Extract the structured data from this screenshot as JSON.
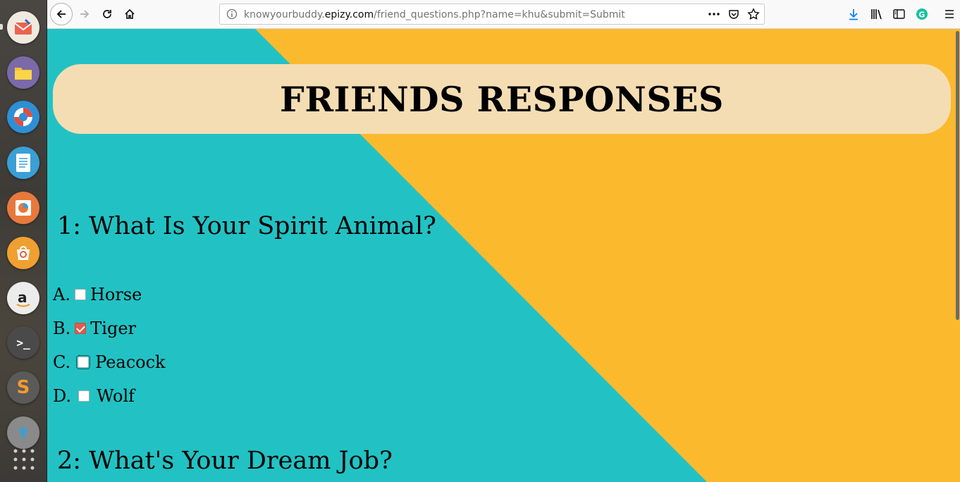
{
  "dock": {
    "items": [
      {
        "name": "mail-app-icon",
        "color": "#e9644f"
      },
      {
        "name": "files-icon",
        "color": "#7a6aa8"
      },
      {
        "name": "help-lifebuoy-icon",
        "color": "#2d8fd5"
      },
      {
        "name": "text-editor-icon",
        "color": "#3a9fd6"
      },
      {
        "name": "impress-icon",
        "color": "#e8793c"
      },
      {
        "name": "software-center-icon",
        "color": "#f0a030"
      },
      {
        "name": "amazon-icon",
        "color": "#e8e8e8"
      },
      {
        "name": "terminal-icon",
        "color": "#4a4a4a"
      },
      {
        "name": "sublime-text-icon",
        "color": "#5a5a5a"
      },
      {
        "name": "update-manager-icon",
        "color": "#6a6a6a"
      },
      {
        "name": "app-grid-icon",
        "color": "#3c3a36"
      }
    ],
    "terminal_glyph": ">_",
    "sublime_glyph": "S"
  },
  "browser": {
    "url_prefix": "knowyourbuddy.",
    "url_host": "epizy.com",
    "url_path": "/friend_questions.php?name=khu&submit=Submit",
    "icons": {
      "back": "back-arrow-icon",
      "forward": "forward-arrow-icon",
      "reload": "reload-icon",
      "home": "home-icon",
      "info": "site-info-icon",
      "more": "page-actions-icon",
      "pocket": "pocket-icon",
      "bookmark": "bookmark-star-icon",
      "download": "download-icon",
      "library": "library-icon",
      "sidebar": "sidebar-icon",
      "grammarly": "grammarly-icon",
      "menu": "hamburger-menu-icon"
    }
  },
  "page": {
    "colors": {
      "teal": "#22c2c4",
      "amber": "#fbb92e",
      "banner": "#f5ddb3"
    },
    "title": "FRIENDS RESPONSES",
    "questions": [
      {
        "label": "1: What Is Your Spirit Animal?",
        "options": [
          {
            "letter": "A.",
            "text": "Horse",
            "checked": false
          },
          {
            "letter": "B.",
            "text": "Tiger",
            "checked": true
          },
          {
            "letter": "C.",
            "text": "Peacock",
            "checked": false
          },
          {
            "letter": "D.",
            "text": "Wolf",
            "checked": false
          }
        ]
      },
      {
        "label": "2: What's Your Dream Job?",
        "options": []
      }
    ]
  }
}
